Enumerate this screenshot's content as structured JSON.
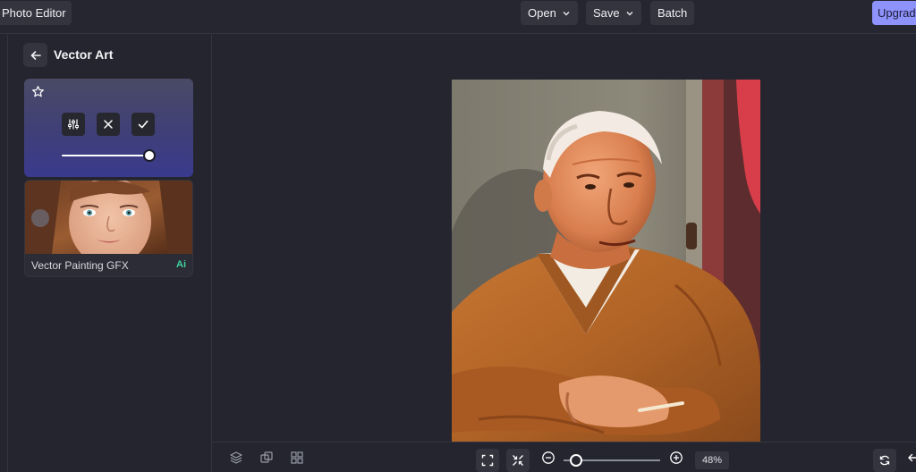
{
  "app": {
    "title": "Photo Editor"
  },
  "toolbar": {
    "open_label": "Open",
    "save_label": "Save",
    "batch_label": "Batch",
    "upgrade_label": "Upgrade"
  },
  "panel": {
    "title": "Vector Art",
    "effect_intensity": 1.0,
    "preset": {
      "label": "Vector Painting GFX",
      "badge": "Ai"
    }
  },
  "zoom": {
    "value": "48%",
    "slider_fraction": 0.06
  },
  "colors": {
    "accent": "#8e92fb",
    "ai_badge": "#3fd3a0",
    "card_gradient_end": "#3a3a8e"
  },
  "icons": [
    "back-arrow-icon",
    "star-icon",
    "adjust-icon",
    "close-icon",
    "check-icon",
    "layers-icon",
    "duplicate-icon",
    "grid-icon",
    "fit-screen-icon",
    "shrink-icon",
    "zoom-out-icon",
    "zoom-in-icon",
    "reset-icon",
    "undo-icon"
  ]
}
